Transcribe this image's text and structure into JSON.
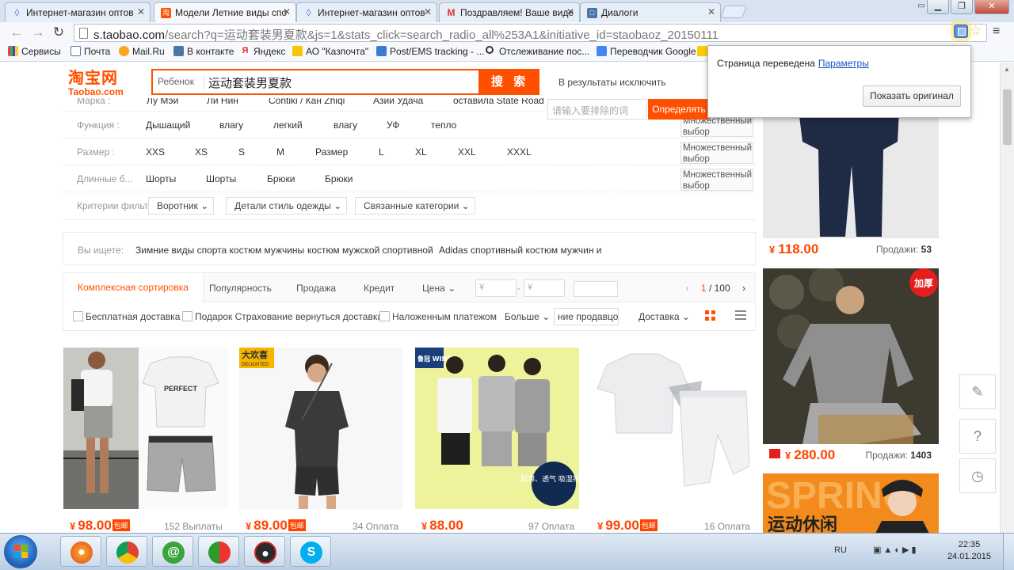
{
  "browser": {
    "tabs": [
      {
        "title": "Интернет-магазин оптов",
        "active": false
      },
      {
        "title": "Модели Летние виды спо",
        "active": true
      },
      {
        "title": "Интернет-магазин оптов",
        "active": false
      },
      {
        "title": "Поздравляем! Ваше виде",
        "active": false
      },
      {
        "title": "Диалоги",
        "active": false
      }
    ],
    "url_host": "s.taobao.com",
    "url_rest": "/search?q=运动套装男夏款&js=1&stats_click=search_radio_all%253A1&initiative_id=staobaoz_20150111",
    "bookmarks": [
      "Сервисы",
      "Почта",
      "Mail.Ru",
      "В контакте",
      "Яндекс",
      "АО \"Казпочта\"",
      "Post/EMS tracking - ...",
      "Отслеживание пос...",
      "Переводчик Google"
    ]
  },
  "translate_popup": {
    "text": "Страница переведена",
    "link": "Параметры",
    "button": "Показать оригинал"
  },
  "header": {
    "logo_cn": "淘宝网",
    "logo_en": "Taobao.com",
    "category": "Ребенок",
    "query": "运动套装男夏款",
    "search_button": "搜 索",
    "exclude_label": "В результаты исключить",
    "exclude_placeholder": "请输入要排除的词",
    "exclude_button": "Определять"
  },
  "filters": {
    "brand": {
      "label": "Марка :",
      "values": [
        "Лу Мэй",
        "Ли Нин",
        "Contiki / Кан Zhiqi",
        "Азии Удача",
        "оставила State Road"
      ]
    },
    "function": {
      "label": "Функция :",
      "values": [
        "Дышащий",
        "влагу",
        "легкий",
        "влагу",
        "УФ",
        "тепло"
      ]
    },
    "size": {
      "label": "Размер :",
      "values": [
        "XXS",
        "XS",
        "S",
        "M",
        "Размер",
        "L",
        "XL",
        "XXL",
        "XXXL"
      ]
    },
    "length": {
      "label": "Длинные б...",
      "values": [
        "Шорты",
        "Шорты",
        "Брюки",
        "Брюки"
      ]
    },
    "criteria": {
      "label": "Критерии фильтра :",
      "dropdowns": [
        "Воротник",
        "Детали стиль одежды",
        "Связанные категории"
      ]
    },
    "multi_select": "Множественный выбор"
  },
  "related": {
    "label": "Вы ищете:",
    "items": [
      "Зимние виды спорта костюм мужчины",
      "костюм мужской спортивной",
      "Adidas спортивный костюм мужчин и"
    ]
  },
  "sort": {
    "tabs": [
      "Комплексная сортировка",
      "Популярность",
      "Продажа",
      "Кредит",
      "Цена"
    ],
    "price_from": "¥",
    "price_to": "¥",
    "page_current": "1",
    "page_total": "/ 100"
  },
  "filterbar": {
    "free_shipping": "Бесплатная доставка",
    "insurance": "Подарок Страхование вернуться доставка",
    "cod": "Наложенным платежом",
    "more": "Больше",
    "seller_box": "ние продавцом",
    "delivery": "Доставка"
  },
  "products": [
    {
      "price": "98.00",
      "sales": "152 Выплаты",
      "free": "包邮"
    },
    {
      "price": "89.00",
      "sales": "34 Оплата",
      "free": "包邮",
      "badge": "大欢喜"
    },
    {
      "price": "88.00",
      "sales": "97 Оплата",
      "free": "",
      "badge": "鲁冠 WINGS"
    },
    {
      "price": "99.00",
      "sales": "16 Оплата",
      "free": "包邮"
    }
  ],
  "side_products": [
    {
      "price": "118.00",
      "sales_label": "Продажи:",
      "sales": "53"
    },
    {
      "price": "280.00",
      "sales_label": "Продажи:",
      "sales": "1403",
      "badge": "加厚"
    },
    {
      "banner_en": "SPRING",
      "banner_cn": "运动休闲"
    }
  ],
  "product_art": {
    "tshirt_print": "PERFECT",
    "breathable_label": "超薄、透气 吸湿排汗",
    "delighted_label": "DELIGHTED"
  },
  "taskbar": {
    "lang": "RU",
    "time": "22:35",
    "date": "24.01.2015"
  },
  "colors": {
    "accent": "#ff5000",
    "price": "#ff4400",
    "link": "#1a55c5"
  }
}
